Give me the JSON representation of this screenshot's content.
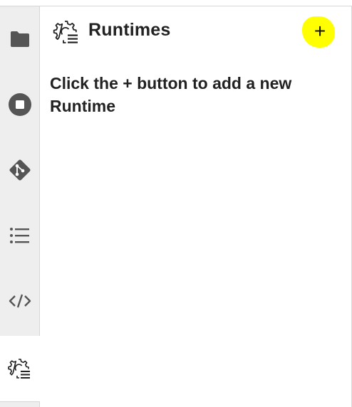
{
  "activity_bar": {
    "items": [
      {
        "name": "file-browser",
        "icon": "folder-icon"
      },
      {
        "name": "running",
        "icon": "stop-circle-icon"
      },
      {
        "name": "git",
        "icon": "git-icon"
      },
      {
        "name": "table-of-contents",
        "icon": "list-icon"
      },
      {
        "name": "code-snippets",
        "icon": "code-icon"
      },
      {
        "name": "runtimes",
        "icon": "runtimes-gear-icon",
        "active": true
      }
    ]
  },
  "panel": {
    "title": "Runtimes",
    "title_icon": "runtimes-gear-icon",
    "add_button_label": "+",
    "add_button_highlight": "#ffff00",
    "empty_message": "Click the + button to add a new Runtime"
  }
}
